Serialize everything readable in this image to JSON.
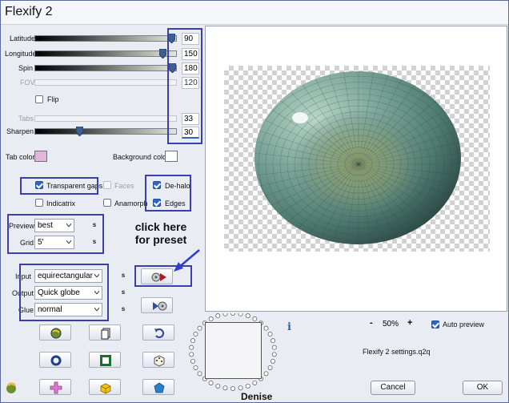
{
  "window": {
    "title": "Flexify 2"
  },
  "sliders": {
    "latitude": {
      "label": "Latitude",
      "value": "90"
    },
    "longitude": {
      "label": "Longitude",
      "value": "150"
    },
    "spin": {
      "label": "Spin",
      "value": "180"
    },
    "fov": {
      "label": "FOV",
      "value": "120"
    },
    "tabs": {
      "label": "Tabs",
      "value": "33"
    },
    "sharpen": {
      "label": "Sharpen",
      "value": "30"
    }
  },
  "flip": {
    "label": "Flip"
  },
  "tab_color": {
    "label": "Tab color",
    "color": "#e3b4dc"
  },
  "background_color": {
    "label": "Background color",
    "color": "#ffffff"
  },
  "options": {
    "transparent_gaps": "Transparent gaps",
    "faces": "Faces",
    "de_halo": "De-halo",
    "indicatrix": "Indicatrix",
    "anamorph": "Anamorph",
    "edges": "Edges"
  },
  "preview_select": {
    "label": "Preview",
    "value": "best"
  },
  "grid_select": {
    "label": "Grid",
    "value": "5'"
  },
  "input_select": {
    "label": "Input",
    "value": "equirectangular"
  },
  "output_select": {
    "label": "Output",
    "value": "Quick globe"
  },
  "glue_select": {
    "label": "Glue",
    "value": "normal"
  },
  "s_label": "s",
  "annotation": {
    "line1": "click here",
    "line2": "for preset"
  },
  "zoom": {
    "minus": "-",
    "value": "50%",
    "plus": "+"
  },
  "auto_preview": {
    "label": "Auto preview"
  },
  "info_icon": "i",
  "settings_file": "Flexify 2 settings.q2q",
  "cancel_label": "Cancel",
  "ok_label": "OK",
  "watermark": "Denise",
  "colors": {
    "highlight": "#3b3fae",
    "accent": "#2f66c5"
  }
}
